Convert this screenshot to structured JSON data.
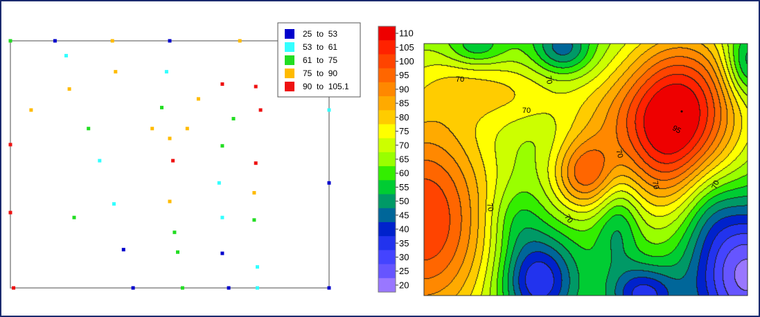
{
  "chart_data": [
    {
      "type": "scatter",
      "title": "",
      "xlim": [
        0,
        100
      ],
      "ylim": [
        0,
        100
      ],
      "legend": {
        "placement": "top-right",
        "entries": [
          {
            "label": "25  to  53",
            "color": "#0000cc",
            "min": 25,
            "max": 53
          },
          {
            "label": "53  to  61",
            "color": "#33ffff",
            "min": 53,
            "max": 61
          },
          {
            "label": "61  to  75",
            "color": "#22dd22",
            "min": 61,
            "max": 75
          },
          {
            "label": "75  to  90",
            "color": "#ffbb00",
            "min": 75,
            "max": 90
          },
          {
            "label": "90  to  105.1",
            "color": "#ee1111",
            "min": 90,
            "max": 105.1
          }
        ]
      },
      "points": [
        {
          "x": 0,
          "y": 100,
          "cls": 2
        },
        {
          "x": 14,
          "y": 100,
          "cls": 0
        },
        {
          "x": 32,
          "y": 100,
          "cls": 3
        },
        {
          "x": 50,
          "y": 100,
          "cls": 0
        },
        {
          "x": 72,
          "y": 100,
          "cls": 3
        },
        {
          "x": 17.5,
          "y": 94,
          "cls": 1
        },
        {
          "x": 33,
          "y": 87.5,
          "cls": 3
        },
        {
          "x": 49,
          "y": 87.5,
          "cls": 1
        },
        {
          "x": 18.5,
          "y": 80.5,
          "cls": 3
        },
        {
          "x": 66.5,
          "y": 82.5,
          "cls": 4
        },
        {
          "x": 77,
          "y": 81.5,
          "cls": 4
        },
        {
          "x": 59,
          "y": 76.5,
          "cls": 3
        },
        {
          "x": 6.5,
          "y": 72,
          "cls": 3
        },
        {
          "x": 47.5,
          "y": 73,
          "cls": 2
        },
        {
          "x": 78.5,
          "y": 72,
          "cls": 4
        },
        {
          "x": 100,
          "y": 72,
          "cls": 1
        },
        {
          "x": 70,
          "y": 68.5,
          "cls": 2
        },
        {
          "x": 24.5,
          "y": 64.5,
          "cls": 2
        },
        {
          "x": 44.5,
          "y": 64.5,
          "cls": 3
        },
        {
          "x": 55.5,
          "y": 64.5,
          "cls": 3
        },
        {
          "x": 0,
          "y": 58,
          "cls": 4
        },
        {
          "x": 50,
          "y": 60.5,
          "cls": 3
        },
        {
          "x": 66.5,
          "y": 57.5,
          "cls": 2
        },
        {
          "x": 28,
          "y": 51.5,
          "cls": 1
        },
        {
          "x": 51,
          "y": 51.5,
          "cls": 4
        },
        {
          "x": 77,
          "y": 50.5,
          "cls": 4
        },
        {
          "x": 65.5,
          "y": 42.5,
          "cls": 1
        },
        {
          "x": 100,
          "y": 42.5,
          "cls": 0
        },
        {
          "x": 76.5,
          "y": 38.5,
          "cls": 3
        },
        {
          "x": 50,
          "y": 35,
          "cls": 3
        },
        {
          "x": 32.5,
          "y": 34,
          "cls": 1
        },
        {
          "x": 0,
          "y": 30.5,
          "cls": 4
        },
        {
          "x": 20,
          "y": 28.5,
          "cls": 2
        },
        {
          "x": 66.5,
          "y": 28.5,
          "cls": 1
        },
        {
          "x": 76.5,
          "y": 27.5,
          "cls": 2
        },
        {
          "x": 51.5,
          "y": 22.5,
          "cls": 2
        },
        {
          "x": 35.5,
          "y": 15.5,
          "cls": 0
        },
        {
          "x": 52.5,
          "y": 14.5,
          "cls": 2
        },
        {
          "x": 66.5,
          "y": 14,
          "cls": 0
        },
        {
          "x": 77.5,
          "y": 8.5,
          "cls": 1
        },
        {
          "x": 1,
          "y": 0,
          "cls": 4
        },
        {
          "x": 38.5,
          "y": 0,
          "cls": 0
        },
        {
          "x": 54,
          "y": 0,
          "cls": 2
        },
        {
          "x": 68.5,
          "y": 0,
          "cls": 0
        },
        {
          "x": 77.5,
          "y": 0,
          "cls": 1
        },
        {
          "x": 100,
          "y": 0,
          "cls": 0
        }
      ]
    },
    {
      "type": "heatmap",
      "title": "",
      "colorbar": {
        "ticks": [
          110,
          105,
          100,
          95,
          90,
          85,
          80,
          75,
          70,
          65,
          60,
          55,
          50,
          45,
          40,
          35,
          30,
          25,
          20
        ],
        "colors": [
          "#ee0000",
          "#ff2200",
          "#ff4400",
          "#ff6600",
          "#ff8800",
          "#ffaa00",
          "#ffcc00",
          "#ffff00",
          "#ccff00",
          "#99ff00",
          "#33ee00",
          "#00cc33",
          "#009966",
          "#006699",
          "#0022cc",
          "#2233ee",
          "#4444ff",
          "#6655ff",
          "#9977ff"
        ]
      },
      "contour_labels": [
        "70",
        "70",
        "70",
        "70",
        "70",
        "70",
        "70",
        "70",
        "95"
      ],
      "surface_hotspots": [
        {
          "x": 80,
          "y": 75,
          "value": 100
        },
        {
          "x": 50,
          "y": 48,
          "value": 88
        },
        {
          "x": 0,
          "y": 30,
          "value": 97
        },
        {
          "x": 35,
          "y": 6,
          "value": 40
        },
        {
          "x": 68,
          "y": 0,
          "value": 42
        },
        {
          "x": 100,
          "y": 8,
          "value": 30
        },
        {
          "x": 100,
          "y": 92,
          "value": 50
        },
        {
          "x": 43,
          "y": 98,
          "value": 55
        },
        {
          "x": 16,
          "y": 98,
          "value": 60
        }
      ]
    }
  ]
}
